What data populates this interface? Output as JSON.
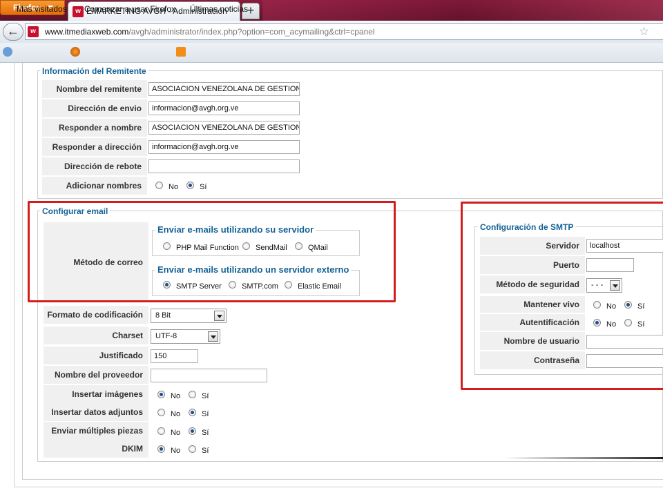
{
  "browser": {
    "menu_button": "Firefox",
    "tab_title": "EMARKETING AVGH - Administración",
    "new_tab": "+",
    "url_domain": "www.itmediaxweb.com",
    "url_prefix": "",
    "url_path": "/avgh/administrator/index.php?option=com_acymailing&ctrl=cpanel",
    "bookmarks": [
      "Más visitados",
      "Comenzar a usar Firefox",
      "Últimas noticias"
    ]
  },
  "sender": {
    "legend": "Información del Remitente",
    "rows": [
      {
        "label": "Nombre del remitente",
        "value": "ASOCIACION VENEZOLANA DE GESTION H"
      },
      {
        "label": "Dirección de envio",
        "value": "informacion@avgh.org.ve"
      },
      {
        "label": "Responder a nombre",
        "value": "ASOCIACION VENEZOLANA DE GESTION H"
      },
      {
        "label": "Responder a dirección",
        "value": "informacion@avgh.org.ve"
      },
      {
        "label": "Dirección de rebote",
        "value": ""
      },
      {
        "label": "Adicionar nombres"
      }
    ],
    "add_names_options": [
      "No",
      "Sí"
    ],
    "add_names_selected": "Sí"
  },
  "email_config": {
    "legend": "Configurar email",
    "method_label": "Método de correo",
    "own_server_legend": "Enviar e-mails utilizando su servidor",
    "own_server_options": [
      "PHP Mail Function",
      "SendMail",
      "QMail"
    ],
    "external_legend": "Enviar e-mails utilizando un servidor externo",
    "external_options": [
      "SMTP Server",
      "SMTP.com",
      "Elastic Email"
    ],
    "selected": "SMTP Server",
    "rows": [
      {
        "label": "Formato de codificación",
        "value": "8 Bit"
      },
      {
        "label": "Charset",
        "value": "UTF-8"
      },
      {
        "label": "Justificado",
        "value": "150"
      },
      {
        "label": "Nombre del proveedor",
        "value": ""
      },
      {
        "label": "Insertar imágenes",
        "selected": "No"
      },
      {
        "label": "Insertar datos adjuntos",
        "selected": "Sí"
      },
      {
        "label": "Enviar múltiples piezas",
        "selected": "Sí"
      },
      {
        "label": "DKIM",
        "selected": "No"
      }
    ],
    "yes_no": [
      "No",
      "Sí"
    ]
  },
  "smtp": {
    "legend": "Configuración de SMTP",
    "rows": [
      {
        "label": "Servidor",
        "value": "localhost"
      },
      {
        "label": "Puerto",
        "value": ""
      },
      {
        "label": "Método de seguridad",
        "value": "- - -"
      },
      {
        "label": "Mantener vivo",
        "selected": "Sí"
      },
      {
        "label": "Autentificación",
        "selected": "No"
      },
      {
        "label": "Nombre de usuario",
        "value": ""
      },
      {
        "label": "Contraseña",
        "value": ""
      }
    ],
    "yes_no": [
      "No",
      "Sí"
    ]
  },
  "colors": {
    "legend_blue": "#146295",
    "highlight_red": "#d41c1c",
    "label_bg": "#f0f0f0"
  }
}
